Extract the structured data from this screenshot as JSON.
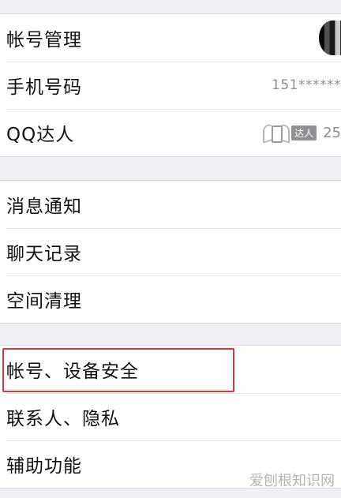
{
  "group1": {
    "items": [
      {
        "label": "帐号管理"
      },
      {
        "label": "手机号码",
        "value": "151******"
      },
      {
        "label": "QQ达人",
        "badge_text": "达人",
        "level": "25"
      }
    ]
  },
  "group2": {
    "items": [
      {
        "label": "消息通知"
      },
      {
        "label": "聊天记录"
      },
      {
        "label": "空间清理"
      }
    ]
  },
  "group3": {
    "items": [
      {
        "label": "帐号、设备安全"
      },
      {
        "label": "联系人、隐私"
      },
      {
        "label": "辅助功能"
      }
    ]
  },
  "watermark": "爱刨根知识网",
  "colors": {
    "background": "#efeff4",
    "highlight": "#d9363e"
  }
}
